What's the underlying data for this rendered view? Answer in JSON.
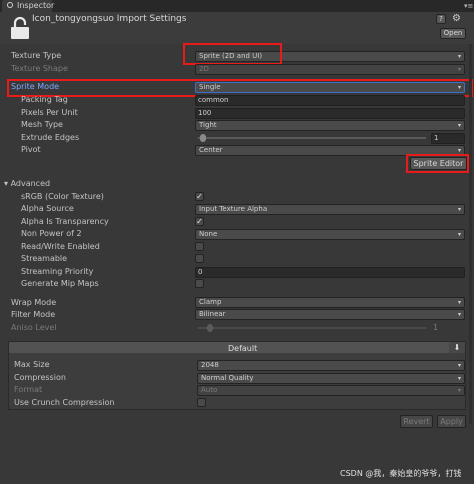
{
  "tab": {
    "title": "Inspector"
  },
  "header": {
    "title": "Icon_tongyongsuo Import Settings",
    "open_label": "Open"
  },
  "fields": {
    "texture_type": {
      "label": "Texture Type",
      "value": "Sprite (2D and UI)"
    },
    "texture_shape": {
      "label": "Texture Shape",
      "value": "2D"
    },
    "sprite_mode": {
      "label": "Sprite Mode",
      "value": "Single"
    },
    "packing_tag": {
      "label": "Packing Tag",
      "value": "common"
    },
    "pixels_per_unit": {
      "label": "Pixels Per Unit",
      "value": "100"
    },
    "mesh_type": {
      "label": "Mesh Type",
      "value": "Tight"
    },
    "extrude_edges": {
      "label": "Extrude Edges",
      "value": "1"
    },
    "pivot": {
      "label": "Pivot",
      "value": "Center"
    },
    "sprite_editor": {
      "label": "Sprite Editor"
    }
  },
  "advanced": {
    "label": "Advanced",
    "srgb": {
      "label": "sRGB (Color Texture)",
      "checked": true
    },
    "alpha_source": {
      "label": "Alpha Source",
      "value": "Input Texture Alpha"
    },
    "alpha_is_transparency": {
      "label": "Alpha Is Transparency",
      "checked": true
    },
    "non_power_of_2": {
      "label": "Non Power of 2",
      "value": "None"
    },
    "read_write": {
      "label": "Read/Write Enabled",
      "checked": false
    },
    "streamable": {
      "label": "Streamable",
      "checked": false
    },
    "streaming_priority": {
      "label": "Streaming Priority",
      "value": "0"
    },
    "generate_mip_maps": {
      "label": "Generate Mip Maps",
      "checked": false
    }
  },
  "wrap": {
    "wrap_mode": {
      "label": "Wrap Mode",
      "value": "Clamp"
    },
    "filter_mode": {
      "label": "Filter Mode",
      "value": "Bilinear"
    },
    "aniso_level": {
      "label": "Aniso Level",
      "value": "1"
    }
  },
  "platform": {
    "tab_label": "Default",
    "max_size": {
      "label": "Max Size",
      "value": "2048"
    },
    "compression": {
      "label": "Compression",
      "value": "Normal Quality"
    },
    "format": {
      "label": "Format",
      "value": "Auto"
    },
    "crunch": {
      "label": "Use Crunch Compression",
      "checked": false
    }
  },
  "buttons": {
    "revert": "Revert",
    "apply": "Apply"
  },
  "watermark": "CSDN @我，秦始皇的爷爷，打钱"
}
